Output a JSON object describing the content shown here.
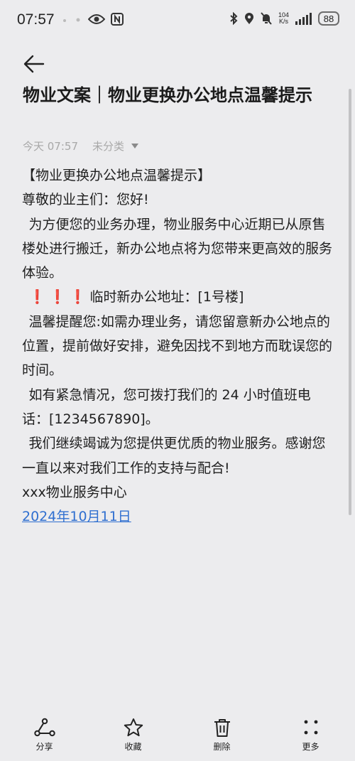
{
  "status_bar": {
    "time": "07:57",
    "net_speed_value": "104",
    "net_speed_unit": "K/s",
    "battery": "88"
  },
  "header": {
    "title": "物业文案｜物业更换办公地点温馨提示"
  },
  "meta": {
    "timestamp": "今天 07:57",
    "category": "未分类"
  },
  "content": {
    "heading": "【物业更换办公地点温馨提示】",
    "greeting": "尊敬的业主们：您好!",
    "paragraph1": "为方便您的业务办理，物业服务中心近期已从原售楼处进行搬迁，新办公地点将为您带来更高效的服务体验。",
    "exclamations": "❗❗❗",
    "address": "临时新办公地址：[1号楼]",
    "paragraph2": "温馨提醒您:如需办理业务，请您留意新办公地点的位置，提前做好安排，避免因找不到地方而耽误您的时间。",
    "paragraph3": "如有紧急情况，您可拨打我们的 24 小时值班电话：[1234567890]。",
    "paragraph4": "我们继续竭诚为您提供更优质的物业服务。感谢您一直以来对我们工作的支持与配合!",
    "signature": "xxx物业服务中心",
    "date": "2024年10月11日"
  },
  "bottom_bar": {
    "share": "分享",
    "favorite": "收藏",
    "delete": "删除",
    "more": "更多"
  },
  "colors": {
    "background": "#ececee",
    "link": "#2f6fd0",
    "exclamation": "#e02828"
  }
}
